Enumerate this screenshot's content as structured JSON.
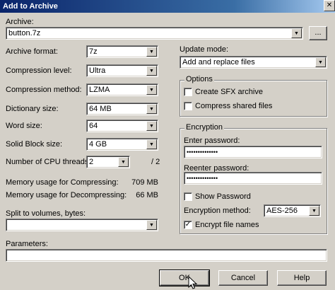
{
  "window": {
    "title": "Add to Archive",
    "close_glyph": "✕"
  },
  "archive": {
    "label": "Archive:",
    "value": "button.7z",
    "browse_label": "..."
  },
  "left": {
    "format": {
      "label": "Archive format:",
      "value": "7z"
    },
    "level": {
      "label": "Compression level:",
      "value": "Ultra"
    },
    "method": {
      "label": "Compression method:",
      "value": "LZMA"
    },
    "dict": {
      "label": "Dictionary size:",
      "value": "64 MB"
    },
    "word": {
      "label": "Word size:",
      "value": "64"
    },
    "solid": {
      "label": "Solid Block size:",
      "value": "4 GB"
    },
    "threads": {
      "label": "Number of CPU threads:",
      "value": "2",
      "max": "/ 2"
    },
    "mem_comp": {
      "label": "Memory usage for Compressing:",
      "value": "709 MB"
    },
    "mem_decomp": {
      "label": "Memory usage for Decompressing:",
      "value": "66 MB"
    },
    "split": {
      "label": "Split to volumes, bytes:",
      "value": ""
    }
  },
  "update": {
    "label": "Update mode:",
    "value": "Add and replace files"
  },
  "options": {
    "title": "Options",
    "sfx": {
      "label": "Create SFX archive",
      "checked": false
    },
    "shared": {
      "label": "Compress shared files",
      "checked": false
    }
  },
  "encryption": {
    "title": "Encryption",
    "enter_label": "Enter password:",
    "enter_value": "••••••••••••••",
    "reenter_label": "Reenter password:",
    "reenter_value": "••••••••••••••",
    "show": {
      "label": "Show Password",
      "checked": false
    },
    "method_label": "Encryption method:",
    "method_value": "AES-256",
    "names": {
      "label": "Encrypt file names",
      "checked": true,
      "mark": "✓"
    }
  },
  "parameters": {
    "label": "Parameters:",
    "value": ""
  },
  "buttons": {
    "ok": "OK",
    "cancel": "Cancel",
    "help": "Help"
  },
  "icons": {
    "dropdown_arrow": "▼",
    "spin_up": "▲",
    "spin_down": "▼"
  }
}
